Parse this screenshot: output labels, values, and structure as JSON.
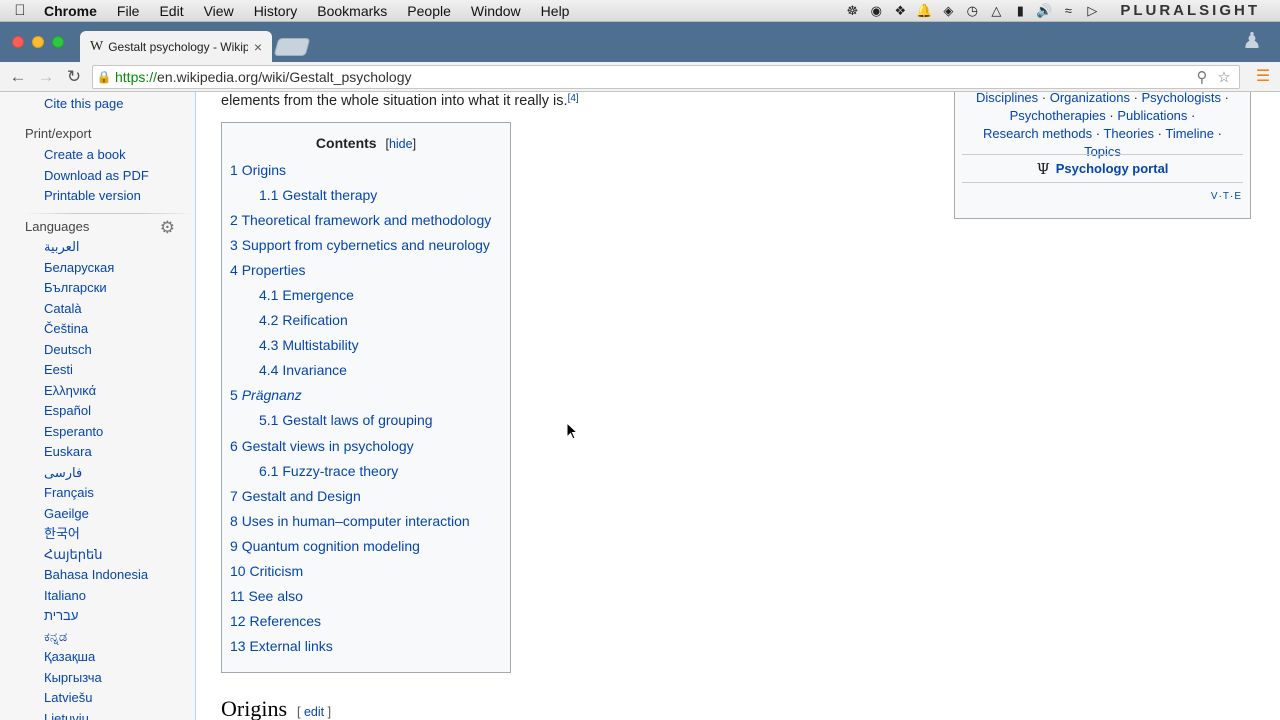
{
  "menubar": {
    "app_name": "Chrome",
    "items": [
      "File",
      "Edit",
      "View",
      "History",
      "Bookmarks",
      "People",
      "Window",
      "Help"
    ],
    "brand": "PLURALSIGHT"
  },
  "tab": {
    "favicon": "W",
    "title": "Gestalt psychology - Wikipe",
    "close": "×"
  },
  "toolbar": {
    "url_scheme": "https://",
    "url_rest": "en.wikipedia.org/wiki/Gestalt_psychology"
  },
  "sidebar": {
    "cite": "Cite this page",
    "print_heading": "Print/export",
    "print_items": [
      "Create a book",
      "Download as PDF",
      "Printable version"
    ],
    "languages_heading": "Languages",
    "languages": [
      "العربية",
      "Беларуская",
      "Български",
      "Català",
      "Čeština",
      "Deutsch",
      "Eesti",
      "Ελληνικά",
      "Español",
      "Esperanto",
      "Euskara",
      "فارسی",
      "Français",
      "Gaeilge",
      "한국어",
      "Հայերեն",
      "Bahasa Indonesia",
      "Italiano",
      "עברית",
      "ಕನ್ನಡ",
      "Қазақша",
      "Кыргызча",
      "Latviešu",
      "Lietuvių"
    ]
  },
  "content": {
    "intro_text": "elements from the whole situation into what it really is.",
    "intro_ref": "[4]",
    "toc": {
      "title": "Contents",
      "hide_label": "hide",
      "items": [
        {
          "num": "1",
          "label": "Origins",
          "level": 1
        },
        {
          "num": "1.1",
          "label": "Gestalt therapy",
          "level": 2
        },
        {
          "num": "2",
          "label": "Theoretical framework and methodology",
          "level": 1
        },
        {
          "num": "3",
          "label": "Support from cybernetics and neurology",
          "level": 1
        },
        {
          "num": "4",
          "label": "Properties",
          "level": 1
        },
        {
          "num": "4.1",
          "label": "Emergence",
          "level": 2
        },
        {
          "num": "4.2",
          "label": "Reification",
          "level": 2
        },
        {
          "num": "4.3",
          "label": "Multistability",
          "level": 2
        },
        {
          "num": "4.4",
          "label": "Invariance",
          "level": 2
        },
        {
          "num": "5",
          "label": "Prägnanz",
          "level": 1,
          "italic": true
        },
        {
          "num": "5.1",
          "label": "Gestalt laws of grouping",
          "level": 2
        },
        {
          "num": "6",
          "label": "Gestalt views in psychology",
          "level": 1
        },
        {
          "num": "6.1",
          "label": "Fuzzy-trace theory",
          "level": 2
        },
        {
          "num": "7",
          "label": "Gestalt and Design",
          "level": 1
        },
        {
          "num": "8",
          "label": "Uses in human–computer interaction",
          "level": 1
        },
        {
          "num": "9",
          "label": "Quantum cognition modeling",
          "level": 1
        },
        {
          "num": "10",
          "label": "Criticism",
          "level": 1
        },
        {
          "num": "11",
          "label": "See also",
          "level": 1
        },
        {
          "num": "12",
          "label": "References",
          "level": 1
        },
        {
          "num": "13",
          "label": "External links",
          "level": 1
        }
      ]
    },
    "navbox": {
      "links_row1": [
        "Disciplines",
        "Organizations",
        "Psychologists"
      ],
      "links_row2": [
        "Psychotherapies",
        "Publications"
      ],
      "links_row3": [
        "Research methods",
        "Theories",
        "Timeline"
      ],
      "links_row4": [
        "Topics"
      ],
      "portal_icon": "Ψ",
      "portal": "Psychology portal",
      "vte": [
        "V",
        "T",
        "E"
      ]
    },
    "section_heading": "Origins",
    "section_edit": "edit"
  }
}
